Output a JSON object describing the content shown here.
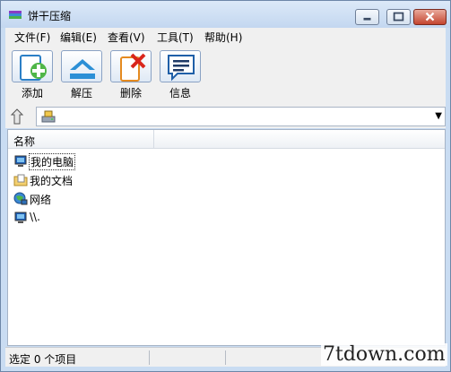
{
  "window": {
    "title": "饼干压缩"
  },
  "menu": [
    "文件(F)",
    "编辑(E)",
    "查看(V)",
    "工具(T)",
    "帮助(H)"
  ],
  "toolbar": {
    "add_label": "添加",
    "extract_label": "解压",
    "delete_label": "删除",
    "info_label": "信息"
  },
  "address": {
    "value": ""
  },
  "list": {
    "column_name": "名称",
    "items": [
      {
        "label": "我的电脑",
        "icon": "computer-icon"
      },
      {
        "label": "我的文档",
        "icon": "documents-folder-icon"
      },
      {
        "label": "网络",
        "icon": "network-icon"
      },
      {
        "label": "\\\\.",
        "icon": "computer-icon"
      }
    ]
  },
  "status": {
    "text": "选定 0 个项目"
  },
  "watermark": "7tdown.com"
}
